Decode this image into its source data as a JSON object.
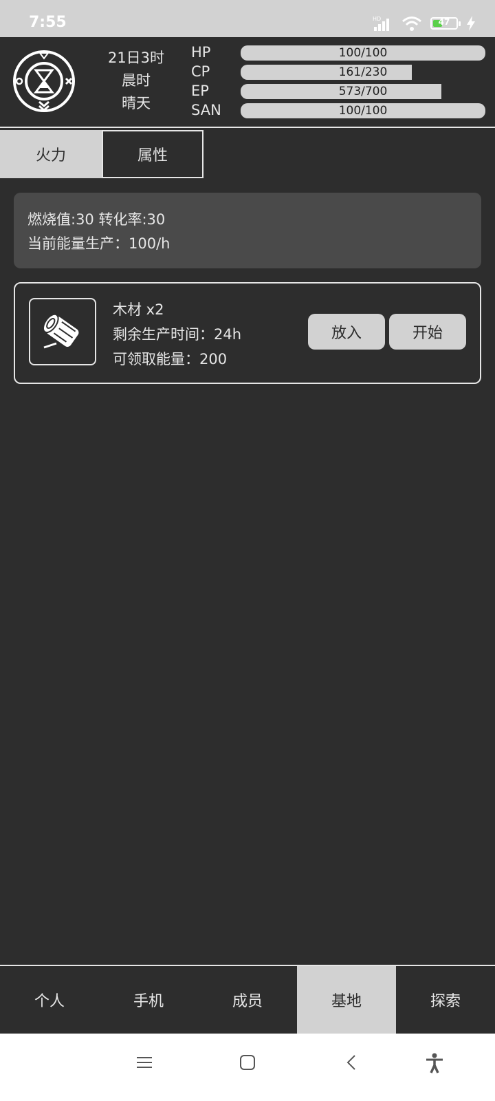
{
  "status_bar": {
    "time": "7:55",
    "signal_badge": "HD",
    "battery_percent": "47",
    "battery_level": 0.47
  },
  "header": {
    "date": "21日3时",
    "period": "晨时",
    "weather": "晴天",
    "stats": [
      {
        "label": "HP",
        "text": "100/100",
        "value": 100,
        "max": 100
      },
      {
        "label": "CP",
        "text": "161/230",
        "value": 161,
        "max": 230
      },
      {
        "label": "EP",
        "text": "573/700",
        "value": 573,
        "max": 700
      },
      {
        "label": "SAN",
        "text": "100/100",
        "value": 100,
        "max": 100
      }
    ]
  },
  "tabs": [
    {
      "label": "火力",
      "active": true
    },
    {
      "label": "属性",
      "active": false
    }
  ],
  "info": {
    "line1": "燃烧值:30 转化率:30",
    "line2": "当前能量生产：100/h"
  },
  "item": {
    "name": "木材 x2",
    "remaining": "剩余生产时间：24h",
    "claimable": "可领取能量：200",
    "put_label": "放入",
    "start_label": "开始"
  },
  "bottom_nav": [
    {
      "label": "个人",
      "active": false
    },
    {
      "label": "手机",
      "active": false
    },
    {
      "label": "成员",
      "active": false
    },
    {
      "label": "基地",
      "active": true
    },
    {
      "label": "探索",
      "active": false
    }
  ],
  "colors": {
    "background": "#2d2d2d",
    "panel": "#4a4a4a",
    "accent_light": "#d2d2d2",
    "text": "#e6e6e6",
    "battery_green": "#5bd04a"
  }
}
